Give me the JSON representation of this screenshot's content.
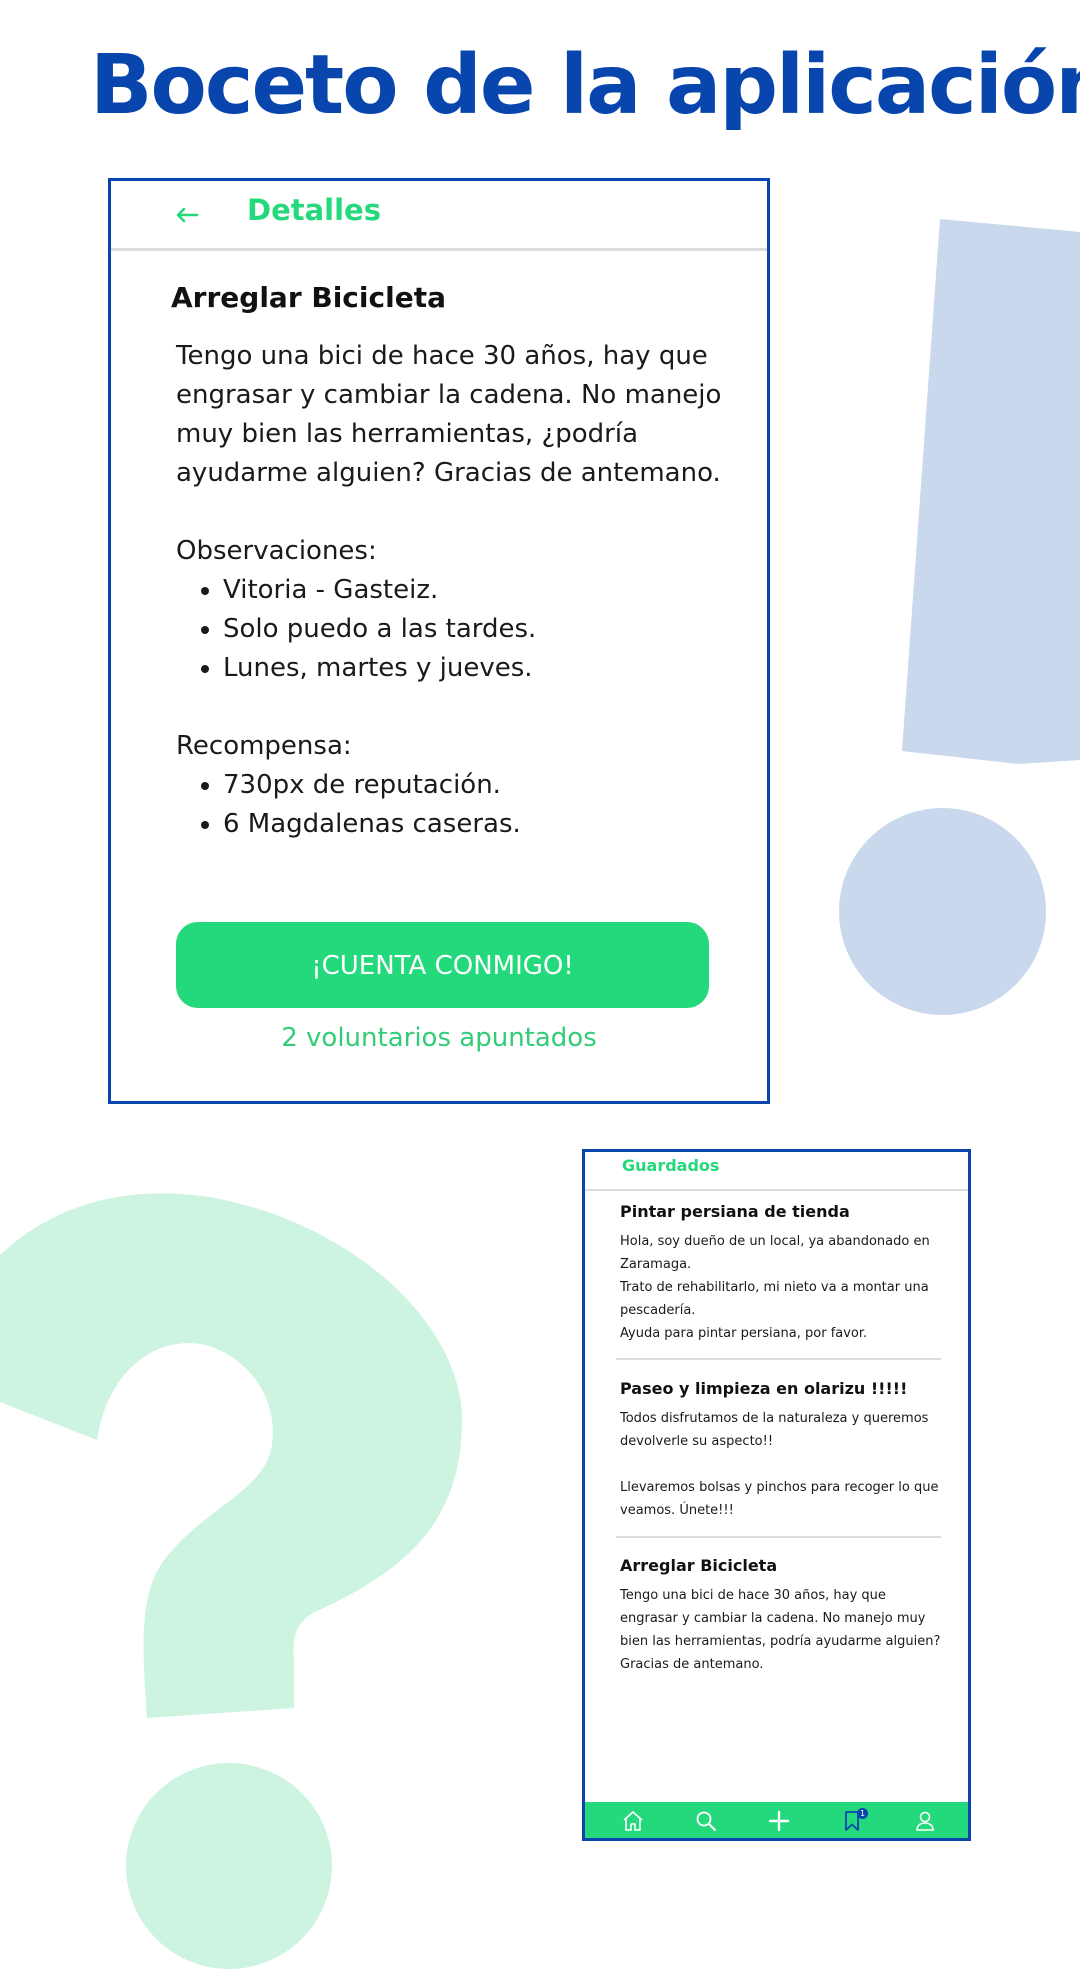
{
  "page": {
    "title": "Boceto de la aplicación"
  },
  "colors": {
    "brand_blue": "#0845ad",
    "accent_green": "#24d97b",
    "exclamation_blue": "#c9d8ec",
    "question_mint": "#cdf4e0"
  },
  "details_screen": {
    "header": {
      "back_icon": "arrow-left-icon",
      "title": "Detalles"
    },
    "task_title": "Arreglar Bicicleta",
    "description": "Tengo una bici de hace 30 años, hay que engrasar y cambiar la cadena. No manejo muy bien las herramientas, ¿podría ayudarme alguien? Gracias de antemano.",
    "observations": {
      "label": "Observaciones:",
      "items": [
        "Vitoria - Gasteiz.",
        "Solo puedo a las tardes.",
        "Lunes, martes y jueves."
      ]
    },
    "reward": {
      "label": "Recompensa:",
      "items": [
        "730px de reputación.",
        "6 Magdalenas caseras."
      ]
    },
    "cta_label": "¡CUENTA CONMIGO!",
    "volunteers_text": "2 voluntarios apuntados"
  },
  "saved_screen": {
    "title": "Guardados",
    "items": [
      {
        "title": "Pintar persiana de tienda",
        "body": "Hola, soy dueño de un local, ya abandonado en Zaramaga.\nTrato de rehabilitarlo, mi nieto va a montar una pescadería.\nAyuda para pintar persiana, por favor."
      },
      {
        "title": "Paseo y limpieza en olarizu !!!!!",
        "body": "Todos disfrutamos de la naturaleza y queremos devolverle su aspecto!!\n\nLlevaremos bolsas y pinchos para recoger lo que veamos. Únete!!!"
      },
      {
        "title": "Arreglar Bicicleta",
        "body": "Tengo una bici de hace 30 años, hay que engrasar y cambiar la cadena. No manejo muy bien las herramientas, podría ayudarme alguien? Gracias de antemano."
      }
    ],
    "tab_bar": {
      "icons": [
        "home-icon",
        "search-icon",
        "plus-icon",
        "bookmark-icon",
        "user-icon"
      ],
      "active": "bookmark-icon",
      "bookmark_badge": "1"
    }
  }
}
